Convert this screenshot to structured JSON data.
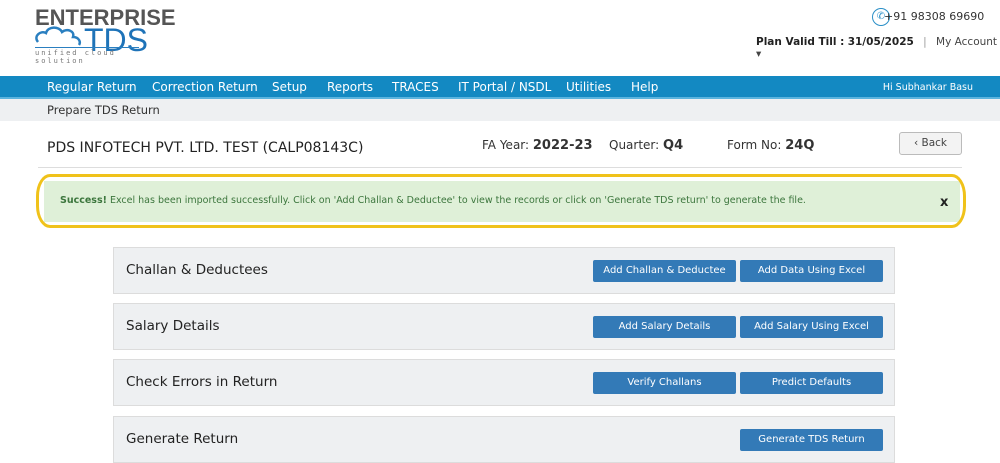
{
  "logo": {
    "line1": "ENTERPRISE",
    "line2": "TDS",
    "tagline": "unified cloud solution"
  },
  "header": {
    "phone": "+91 98308 69690",
    "plan_label": "Plan Valid Till :",
    "plan_date": "31/05/2025",
    "separator": "|",
    "account": "My Account ▾"
  },
  "nav": {
    "items": [
      "Regular Return",
      "Correction Return",
      "Setup",
      "Reports",
      "TRACES",
      "IT Portal / NSDL",
      "Utilities",
      "Help"
    ],
    "greeting": "Hi Subhankar Basu"
  },
  "breadcrumb": "Prepare TDS Return",
  "info": {
    "company": "PDS INFOTECH PVT. LTD. TEST (CALP08143C)",
    "fa_label": "FA Year:",
    "fa_value": "2022-23",
    "quarter_label": "Quarter:",
    "quarter_value": "Q4",
    "form_label": "Form No:",
    "form_value": "24Q",
    "back": "Back"
  },
  "alert": {
    "strong": "Success!",
    "message": " Excel has been imported successfully. Click on 'Add Challan & Deductee' to view the records or click on 'Generate TDS return' to generate the file.",
    "close": "x"
  },
  "panels": [
    {
      "title": "Challan & Deductees",
      "buttons": [
        "Add Challan & Deductee",
        "Add Data Using Excel"
      ]
    },
    {
      "title": "Salary Details",
      "buttons": [
        "Add Salary Details",
        "Add Salary Using Excel"
      ]
    },
    {
      "title": "Check Errors in Return",
      "buttons": [
        "Verify Challans",
        "Predict Defaults"
      ]
    },
    {
      "title": "Generate Return",
      "buttons": [
        "Generate TDS Return"
      ]
    }
  ]
}
